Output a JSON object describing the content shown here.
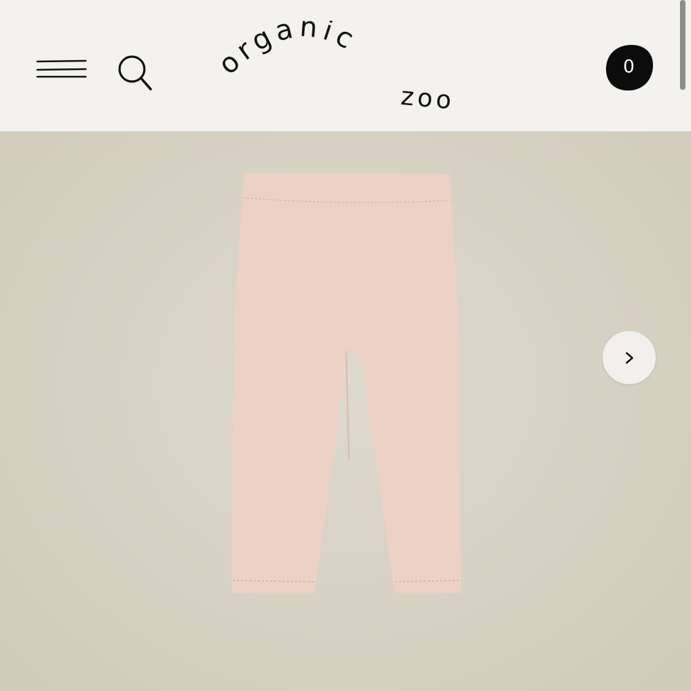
{
  "header": {
    "logo": {
      "line1": "organic",
      "line2": "zoo"
    },
    "cart": {
      "count": "0"
    }
  },
  "icons": {
    "menu": "hamburger-menu-icon",
    "search": "search-icon",
    "cart": "cart-blob-icon",
    "next": "chevron-right-icon"
  },
  "product_image": {
    "pattern": "moon-print",
    "fabric_color": "#ecd2c4",
    "print_color": "#26272b"
  },
  "colors": {
    "header_bg": "#f3f2ee",
    "stage_bg": "#d8d3c6",
    "ink": "#111111"
  }
}
